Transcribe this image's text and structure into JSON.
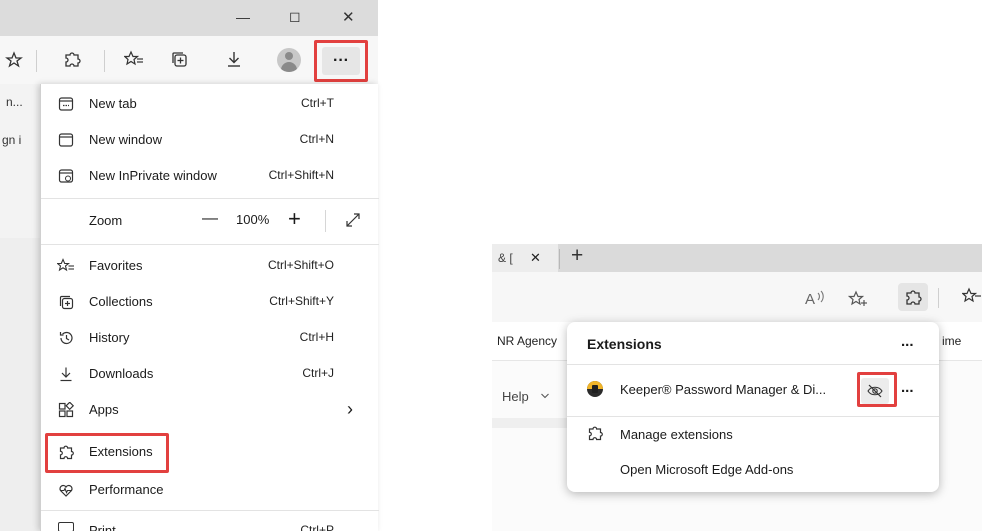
{
  "left": {
    "window_controls": {
      "minimize": "—",
      "restore": "◻",
      "close": "✕"
    },
    "cut_tab_text": "n...",
    "cut_page_text": "gn i",
    "menu": {
      "items": [
        {
          "label": "New tab",
          "shortcut": "Ctrl+T",
          "icon": "new-tab-icon"
        },
        {
          "label": "New window",
          "shortcut": "Ctrl+N",
          "icon": "new-window-icon"
        },
        {
          "label": "New InPrivate window",
          "shortcut": "Ctrl+Shift+N",
          "icon": "inprivate-icon"
        }
      ],
      "zoom": {
        "label": "Zoom",
        "minus": "—",
        "value": "100%",
        "plus": "+"
      },
      "items2": [
        {
          "label": "Favorites",
          "shortcut": "Ctrl+Shift+O",
          "icon": "favorites-icon"
        },
        {
          "label": "Collections",
          "shortcut": "Ctrl+Shift+Y",
          "icon": "collections-icon"
        },
        {
          "label": "History",
          "shortcut": "Ctrl+H",
          "icon": "history-icon"
        },
        {
          "label": "Downloads",
          "shortcut": "Ctrl+J",
          "icon": "downloads-icon"
        },
        {
          "label": "Apps",
          "shortcut": "",
          "icon": "apps-icon"
        },
        {
          "label": "Extensions",
          "shortcut": "",
          "icon": "extensions-icon"
        },
        {
          "label": "Performance",
          "shortcut": "",
          "icon": "performance-icon"
        }
      ],
      "apps_arrow": "›",
      "cut_print_label": "Print",
      "cut_print_shortcut": "Ctrl+P"
    },
    "colors": {
      "highlight": "#e2403f",
      "titlebar": "#dcdcdc"
    }
  },
  "right": {
    "tab_text": "& [",
    "tab_close": "✕",
    "new_tab": "+",
    "fav_left": "NR Agency",
    "fav_right": "ime",
    "help_label": "Help",
    "extensions_panel": {
      "title": "Extensions",
      "more": "...",
      "item_name": "Keeper® Password Manager & Di...",
      "item_more": "...",
      "manage": "Manage extensions",
      "addons": "Open Microsoft Edge Add-ons"
    }
  }
}
